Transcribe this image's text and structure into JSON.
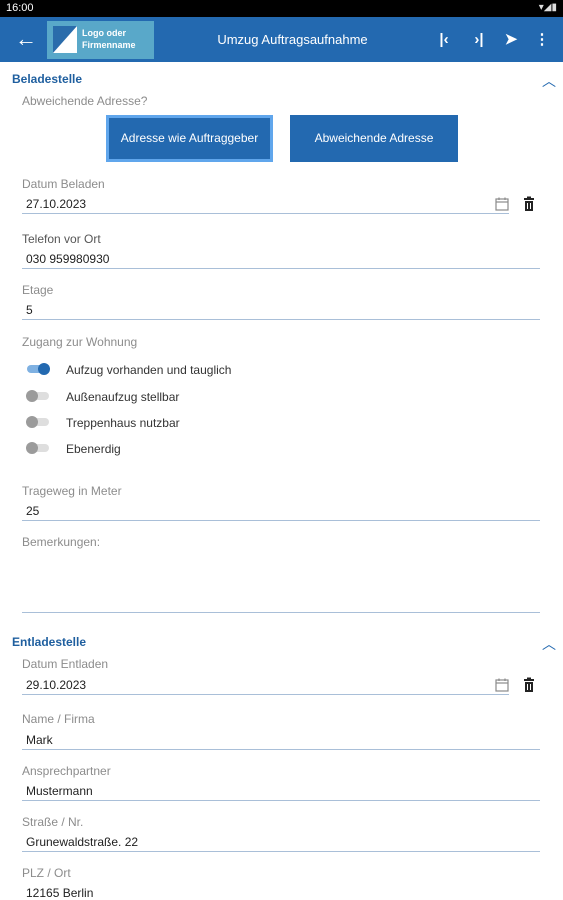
{
  "status_bar": {
    "time": "16:00",
    "icons": "▾◢▮"
  },
  "app_bar": {
    "back_icon": "arrow-left-icon",
    "logo_text": "Logo oder Firmenname",
    "title": "Umzug Auftragsaufnahme",
    "actions": [
      {
        "name": "first-icon",
        "glyph": "|‹"
      },
      {
        "name": "last-icon",
        "glyph": "›|"
      },
      {
        "name": "send-icon",
        "glyph": "➤"
      },
      {
        "name": "more-icon",
        "glyph": "⋮"
      }
    ]
  },
  "beladestelle": {
    "title": "Beladestelle",
    "abweichende_label": "Abweichende Adresse?",
    "btn_auftraggeber": "Adresse wie Auftraggeber",
    "btn_abweichend": "Abweichende Adresse",
    "datum_label": "Datum Beladen",
    "datum_value": "27.10.2023",
    "telefon_label": "Telefon vor Ort",
    "telefon_value": "030 959980930",
    "etage_label": "Etage",
    "etage_value": "5",
    "zugang_label": "Zugang zur Wohnung",
    "toggles": [
      {
        "label": "Aufzug vorhanden und tauglich",
        "on": true
      },
      {
        "label": "Außenaufzug stellbar",
        "on": false
      },
      {
        "label": "Treppenhaus nutzbar",
        "on": false
      },
      {
        "label": "Ebenerdig",
        "on": false
      }
    ],
    "trageweg_label": "Trageweg in Meter",
    "trageweg_value": "25",
    "bemerkungen_label": "Bemerkungen:",
    "bemerkungen_value": ""
  },
  "entladestelle": {
    "title": "Entladestelle",
    "datum_label": "Datum Entladen",
    "datum_value": "29.10.2023",
    "name_label": "Name / Firma",
    "name_value": "Mark",
    "ansprech_label": "Ansprechpartner",
    "ansprech_value": "Mustermann",
    "strasse_label": "Straße / Nr.",
    "strasse_value": "Grunewaldstraße. 22",
    "plz_label": "PLZ / Ort",
    "plz_value": "12165 Berlin"
  },
  "colors": {
    "primary": "#2369b0",
    "logo_bg": "#59a8c9",
    "underline": "#a9bfd8"
  }
}
